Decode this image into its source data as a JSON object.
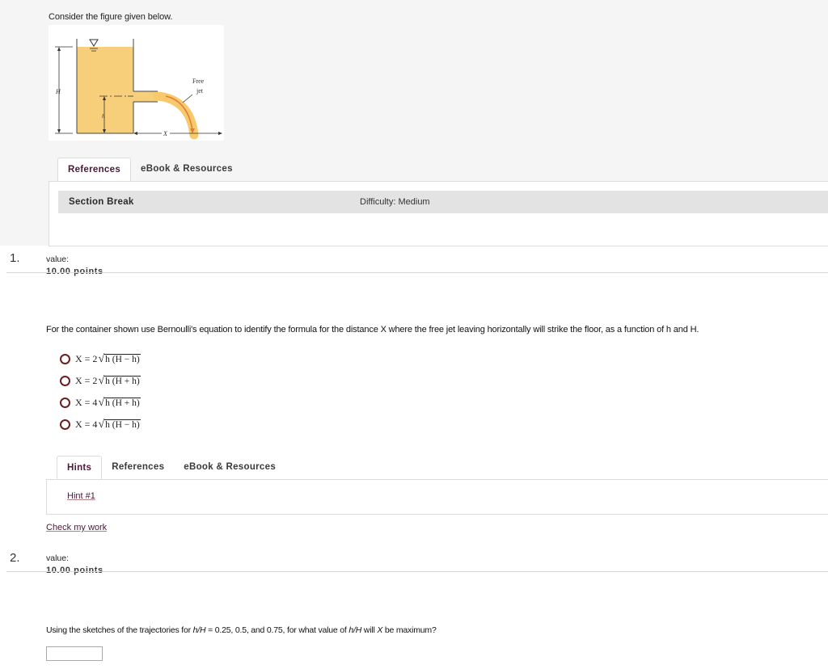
{
  "intro": "Consider the figure given below.",
  "figure": {
    "labels": {
      "H": "H",
      "h": "h",
      "X": "X",
      "free": "Free",
      "jet": "jet"
    },
    "colors": {
      "water": "#f7cf7a",
      "jet": "#f7c96a",
      "arrow": "#e07a3a",
      "line": "#333333"
    }
  },
  "tabs_top": [
    "References",
    "eBook & Resources"
  ],
  "section": {
    "label": "Section Break",
    "difficulty": "Difficulty: Medium"
  },
  "questions": [
    {
      "number": "1.",
      "value_label": "value:",
      "points": "10.00 points",
      "text": "For the container shown use Bernoulli's equation to identify the formula for the distance X where the free jet leaving horizontally will strike the floor, as a function of h and H.",
      "options": [
        {
          "lhs": "X = 2",
          "radicand": "h (H − h)"
        },
        {
          "lhs": "X = 2",
          "radicand": "h (H + h)"
        },
        {
          "lhs": "X = 4",
          "radicand": "h (H + h)"
        },
        {
          "lhs": "X = 4",
          "radicand": "h (H − h)"
        }
      ],
      "tabs": [
        "Hints",
        "References",
        "eBook & Resources"
      ],
      "hint_link": "Hint #1",
      "check_link": "Check my work"
    },
    {
      "number": "2.",
      "value_label": "value:",
      "points": "10.00 points",
      "text_parts": {
        "a": "Using the sketches of the trajectories for ",
        "b": "h/H",
        "c": " = 0.25, 0.5, and 0.75, for what value of ",
        "d": "h/H",
        "e": " will ",
        "f": "X",
        "g": " be maximum?"
      },
      "answer_value": ""
    }
  ]
}
